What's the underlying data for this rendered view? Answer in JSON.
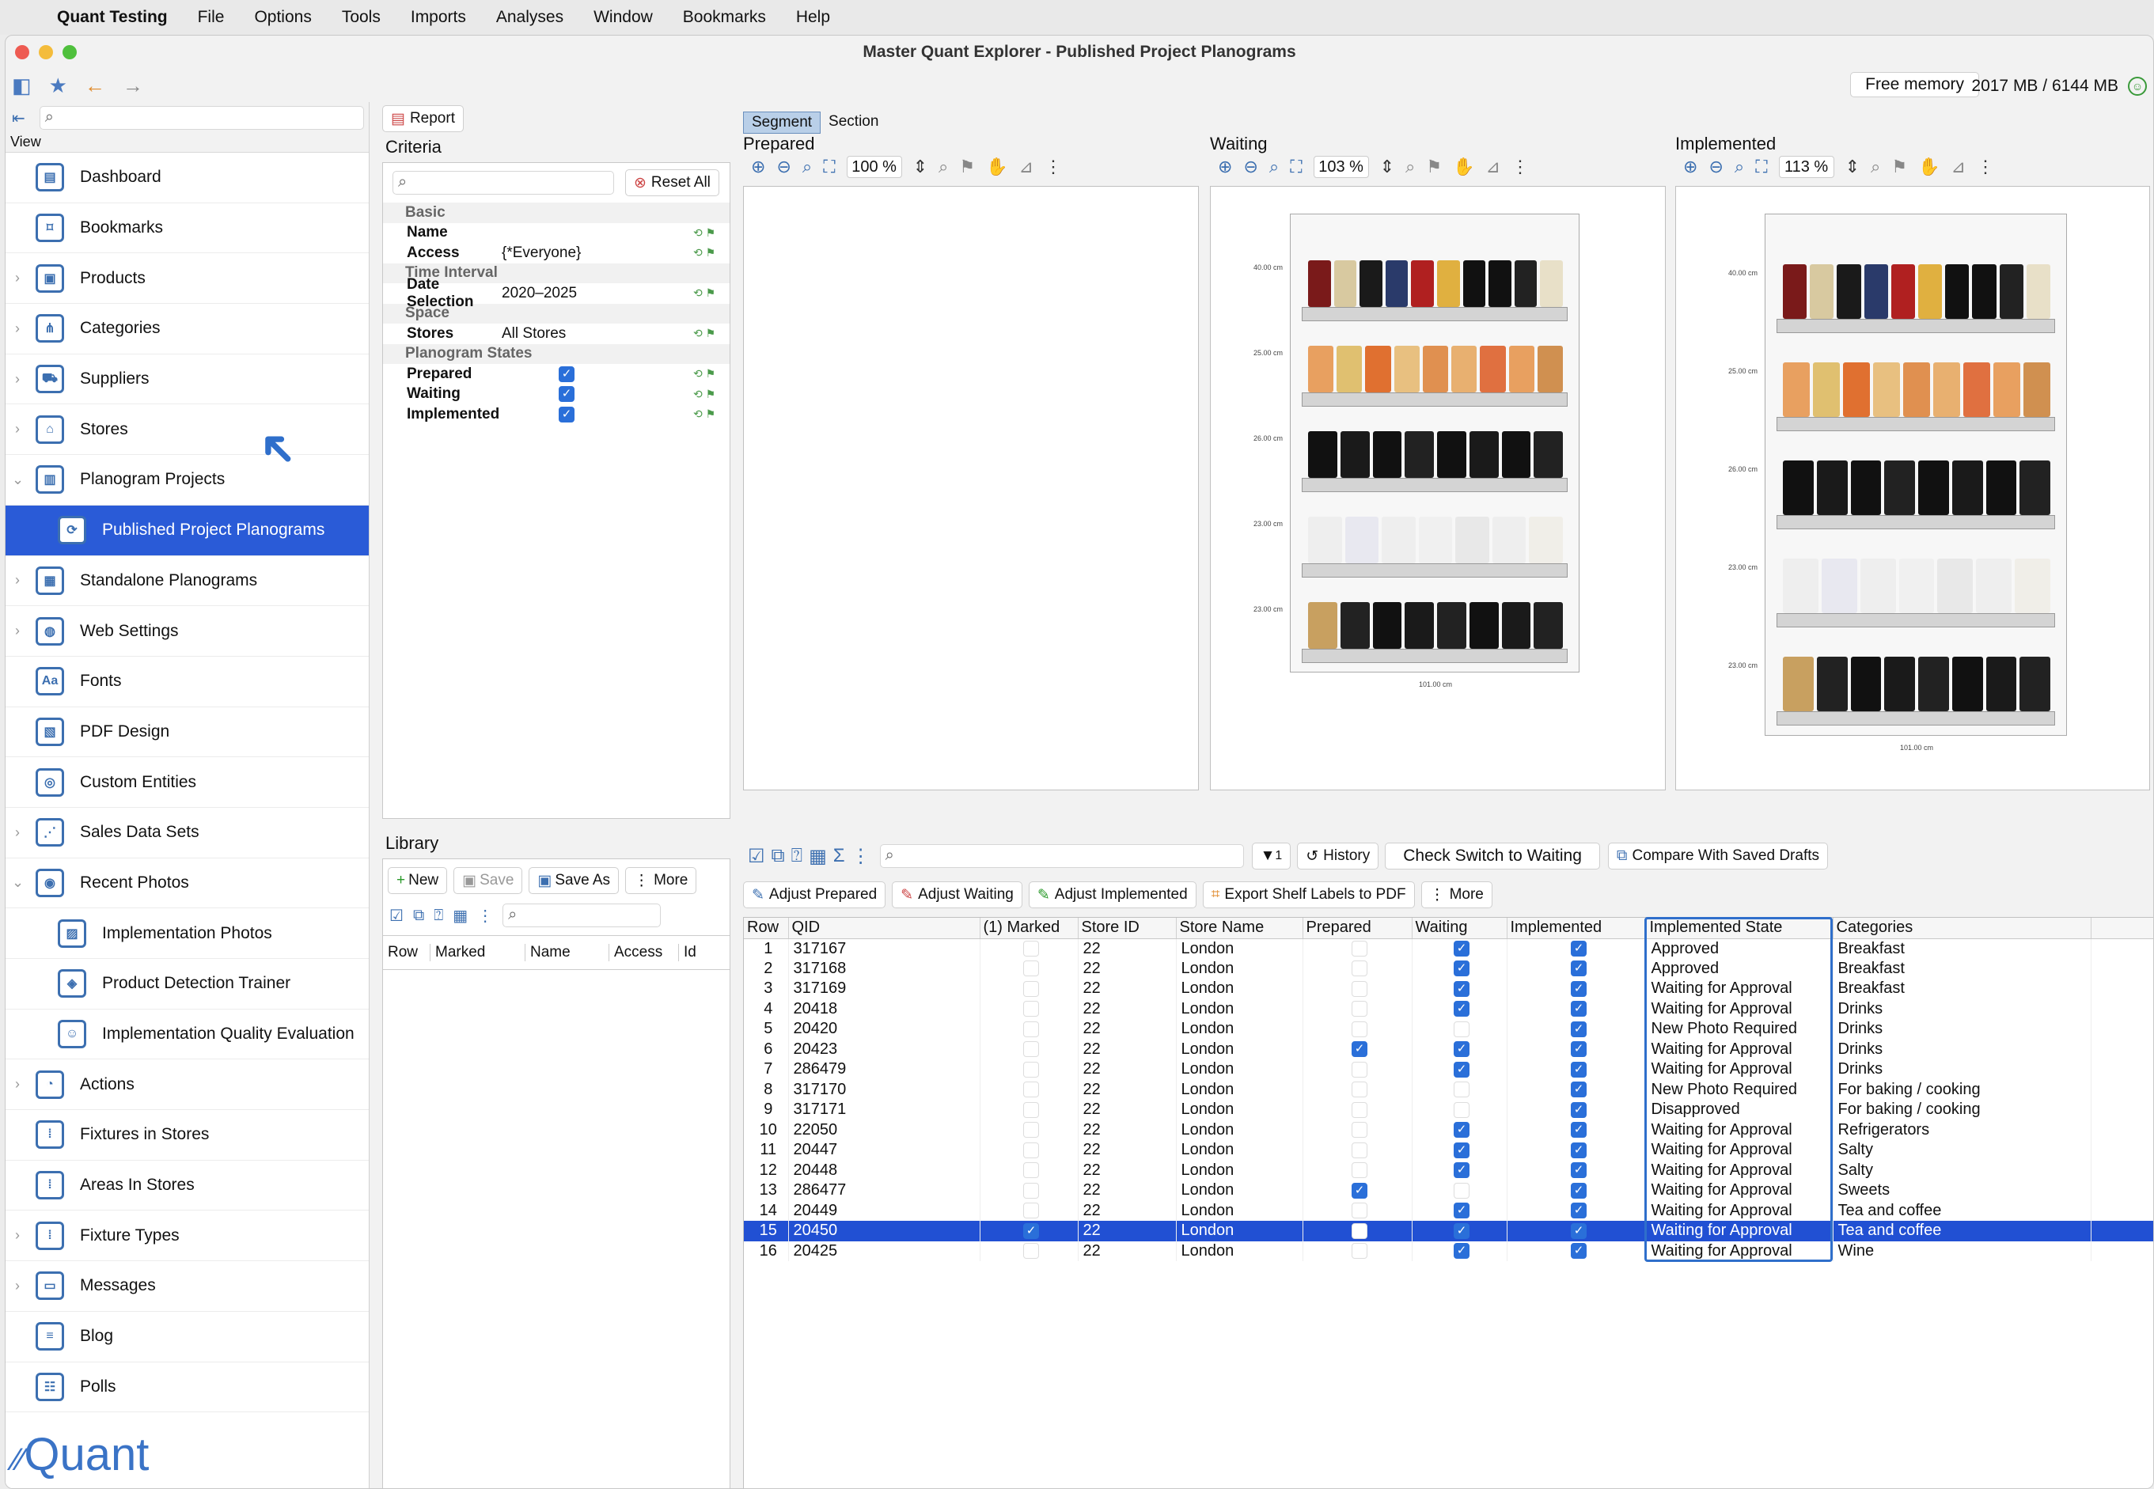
{
  "menubar": {
    "app": "Quant Testing",
    "items": [
      "File",
      "Options",
      "Tools",
      "Imports",
      "Analyses",
      "Window",
      "Bookmarks",
      "Help"
    ]
  },
  "window": {
    "title": "Master Quant Explorer - Published Project Planograms",
    "free_memory_label": "Free memory",
    "memory_value": "2017 MB / 6144 MB"
  },
  "sidebar": {
    "view_label": "View",
    "items": [
      {
        "label": "Dashboard",
        "icon": "dashboard-icon",
        "chev": "",
        "sub": false
      },
      {
        "label": "Bookmarks",
        "icon": "bookmark-icon",
        "chev": "",
        "sub": false
      },
      {
        "label": "Products",
        "icon": "product-icon",
        "chev": "›",
        "sub": false
      },
      {
        "label": "Categories",
        "icon": "categories-icon",
        "chev": "›",
        "sub": false
      },
      {
        "label": "Suppliers",
        "icon": "suppliers-icon",
        "chev": "›",
        "sub": false
      },
      {
        "label": "Stores",
        "icon": "store-icon",
        "chev": "›",
        "sub": false
      },
      {
        "label": "Planogram Projects",
        "icon": "planogram-projects-icon",
        "chev": "⌄",
        "sub": false
      },
      {
        "label": "Published Project Planograms",
        "icon": "published-planogram-icon",
        "chev": "",
        "sub": true,
        "selected": true
      },
      {
        "label": "Standalone Planograms",
        "icon": "standalone-planogram-icon",
        "chev": "›",
        "sub": false
      },
      {
        "label": "Web Settings",
        "icon": "globe-icon",
        "chev": "›",
        "sub": false
      },
      {
        "label": "Fonts",
        "icon": "fonts-icon",
        "chev": "",
        "sub": false
      },
      {
        "label": "PDF Design",
        "icon": "pdf-design-icon",
        "chev": "",
        "sub": false
      },
      {
        "label": "Custom Entities",
        "icon": "custom-entities-icon",
        "chev": "",
        "sub": false
      },
      {
        "label": "Sales Data Sets",
        "icon": "sales-data-icon",
        "chev": "›",
        "sub": false
      },
      {
        "label": "Recent Photos",
        "icon": "camera-icon",
        "chev": "⌄",
        "sub": false
      },
      {
        "label": "Implementation Photos",
        "icon": "photo-icon",
        "chev": "",
        "sub": true
      },
      {
        "label": "Product Detection Trainer",
        "icon": "detection-trainer-icon",
        "chev": "",
        "sub": true
      },
      {
        "label": "Implementation Quality Evaluation",
        "icon": "quality-evaluation-icon",
        "chev": "",
        "sub": true
      },
      {
        "label": "Actions",
        "icon": "actions-icon",
        "chev": "›",
        "sub": false
      },
      {
        "label": "Fixtures in Stores",
        "icon": "fixtures-icon",
        "chev": "",
        "sub": false
      },
      {
        "label": "Areas In Stores",
        "icon": "areas-icon",
        "chev": "",
        "sub": false
      },
      {
        "label": "Fixture Types",
        "icon": "fixture-types-icon",
        "chev": "›",
        "sub": false
      },
      {
        "label": "Messages",
        "icon": "messages-icon",
        "chev": "›",
        "sub": false
      },
      {
        "label": "Blog",
        "icon": "blog-icon",
        "chev": "",
        "sub": false
      },
      {
        "label": "Polls",
        "icon": "polls-icon",
        "chev": "",
        "sub": false
      }
    ],
    "logo": "Quant"
  },
  "criteria": {
    "report_label": "Report",
    "title": "Criteria",
    "reset_label": "Reset All",
    "groups": [
      {
        "name": "Basic",
        "rows": [
          {
            "k": "Name",
            "v": ""
          },
          {
            "k": "Access",
            "v": "{*Everyone}"
          }
        ]
      },
      {
        "name": "Time Interval",
        "rows": [
          {
            "k": "Date Selection",
            "v": "2020–2025"
          }
        ]
      },
      {
        "name": "Space",
        "rows": [
          {
            "k": "Stores",
            "v": "All Stores"
          }
        ]
      },
      {
        "name": "Planogram States",
        "rows": [
          {
            "k": "Prepared",
            "v": "✓"
          },
          {
            "k": "Waiting",
            "v": "✓"
          },
          {
            "k": "Implemented",
            "v": "✓"
          }
        ]
      }
    ]
  },
  "library": {
    "title": "Library",
    "new_label": "New",
    "save_label": "Save",
    "save_as_label": "Save As",
    "more_label": "More",
    "columns": [
      "Row",
      "Marked",
      "Name",
      "Access",
      "Id"
    ]
  },
  "planograms": {
    "tabs": [
      "Segment",
      "Section"
    ],
    "panels": [
      {
        "title": "Prepared",
        "zoom": "100 %"
      },
      {
        "title": "Waiting",
        "zoom": "103 %"
      },
      {
        "title": "Implemented",
        "zoom": "113 %"
      }
    ],
    "shelf_labels": [
      "40.00 cm",
      "25.00 cm",
      "26.00 cm",
      "23.00 cm",
      "23.00 cm"
    ],
    "width_label": "101.00 cm"
  },
  "grid": {
    "history_label": "History",
    "check_switch_label": "Check Switch to Waiting",
    "compare_label": "Compare With Saved Drafts",
    "filter_count": "1",
    "actions": [
      "Adjust Prepared",
      "Adjust Waiting",
      "Adjust Implemented",
      "Export Shelf Labels to PDF",
      "More"
    ],
    "columns": [
      "Row",
      "QID",
      "(1) Marked",
      "Store ID",
      "Store Name",
      "Prepared",
      "Waiting",
      "Implemented",
      "Implemented State",
      "Categories"
    ],
    "sort_indicator": "1",
    "rows": [
      {
        "row": "1",
        "qid": "317167",
        "marked": false,
        "store": "22",
        "name": "London",
        "prep": false,
        "wait": true,
        "impl": true,
        "state": "Approved",
        "cat": "Breakfast"
      },
      {
        "row": "2",
        "qid": "317168",
        "marked": false,
        "store": "22",
        "name": "London",
        "prep": false,
        "wait": true,
        "impl": true,
        "state": "Approved",
        "cat": "Breakfast"
      },
      {
        "row": "3",
        "qid": "317169",
        "marked": false,
        "store": "22",
        "name": "London",
        "prep": false,
        "wait": true,
        "impl": true,
        "state": "Waiting for Approval",
        "cat": "Breakfast"
      },
      {
        "row": "4",
        "qid": "20418",
        "marked": false,
        "store": "22",
        "name": "London",
        "prep": false,
        "wait": true,
        "impl": true,
        "state": "Waiting for Approval",
        "cat": "Drinks"
      },
      {
        "row": "5",
        "qid": "20420",
        "marked": false,
        "store": "22",
        "name": "London",
        "prep": false,
        "wait": false,
        "impl": true,
        "state": "New Photo Required",
        "cat": "Drinks"
      },
      {
        "row": "6",
        "qid": "20423",
        "marked": false,
        "store": "22",
        "name": "London",
        "prep": true,
        "wait": true,
        "impl": true,
        "state": "Waiting for Approval",
        "cat": "Drinks"
      },
      {
        "row": "7",
        "qid": "286479",
        "marked": false,
        "store": "22",
        "name": "London",
        "prep": false,
        "wait": true,
        "impl": true,
        "state": "Waiting for Approval",
        "cat": "Drinks"
      },
      {
        "row": "8",
        "qid": "317170",
        "marked": false,
        "store": "22",
        "name": "London",
        "prep": false,
        "wait": false,
        "impl": true,
        "state": "New Photo Required",
        "cat": "For baking / cooking"
      },
      {
        "row": "9",
        "qid": "317171",
        "marked": false,
        "store": "22",
        "name": "London",
        "prep": false,
        "wait": false,
        "impl": true,
        "state": "Disapproved",
        "cat": "For baking / cooking"
      },
      {
        "row": "10",
        "qid": "22050",
        "marked": false,
        "store": "22",
        "name": "London",
        "prep": false,
        "wait": true,
        "impl": true,
        "state": "Waiting for Approval",
        "cat": "Refrigerators"
      },
      {
        "row": "11",
        "qid": "20447",
        "marked": false,
        "store": "22",
        "name": "London",
        "prep": false,
        "wait": true,
        "impl": true,
        "state": "Waiting for Approval",
        "cat": "Salty"
      },
      {
        "row": "12",
        "qid": "20448",
        "marked": false,
        "store": "22",
        "name": "London",
        "prep": false,
        "wait": true,
        "impl": true,
        "state": "Waiting for Approval",
        "cat": "Salty"
      },
      {
        "row": "13",
        "qid": "286477",
        "marked": false,
        "store": "22",
        "name": "London",
        "prep": true,
        "wait": false,
        "impl": true,
        "state": "Waiting for Approval",
        "cat": "Sweets"
      },
      {
        "row": "14",
        "qid": "20449",
        "marked": false,
        "store": "22",
        "name": "London",
        "prep": false,
        "wait": true,
        "impl": true,
        "state": "Waiting for Approval",
        "cat": "Tea and coffee"
      },
      {
        "row": "15",
        "qid": "20450",
        "marked": true,
        "store": "22",
        "name": "London",
        "prep": false,
        "wait": true,
        "impl": true,
        "state": "Waiting for Approval",
        "cat": "Tea and coffee",
        "selected": true
      },
      {
        "row": "16",
        "qid": "20425",
        "marked": false,
        "store": "22",
        "name": "London",
        "prep": false,
        "wait": true,
        "impl": true,
        "state": "Waiting for Approval",
        "cat": "Wine"
      }
    ]
  }
}
